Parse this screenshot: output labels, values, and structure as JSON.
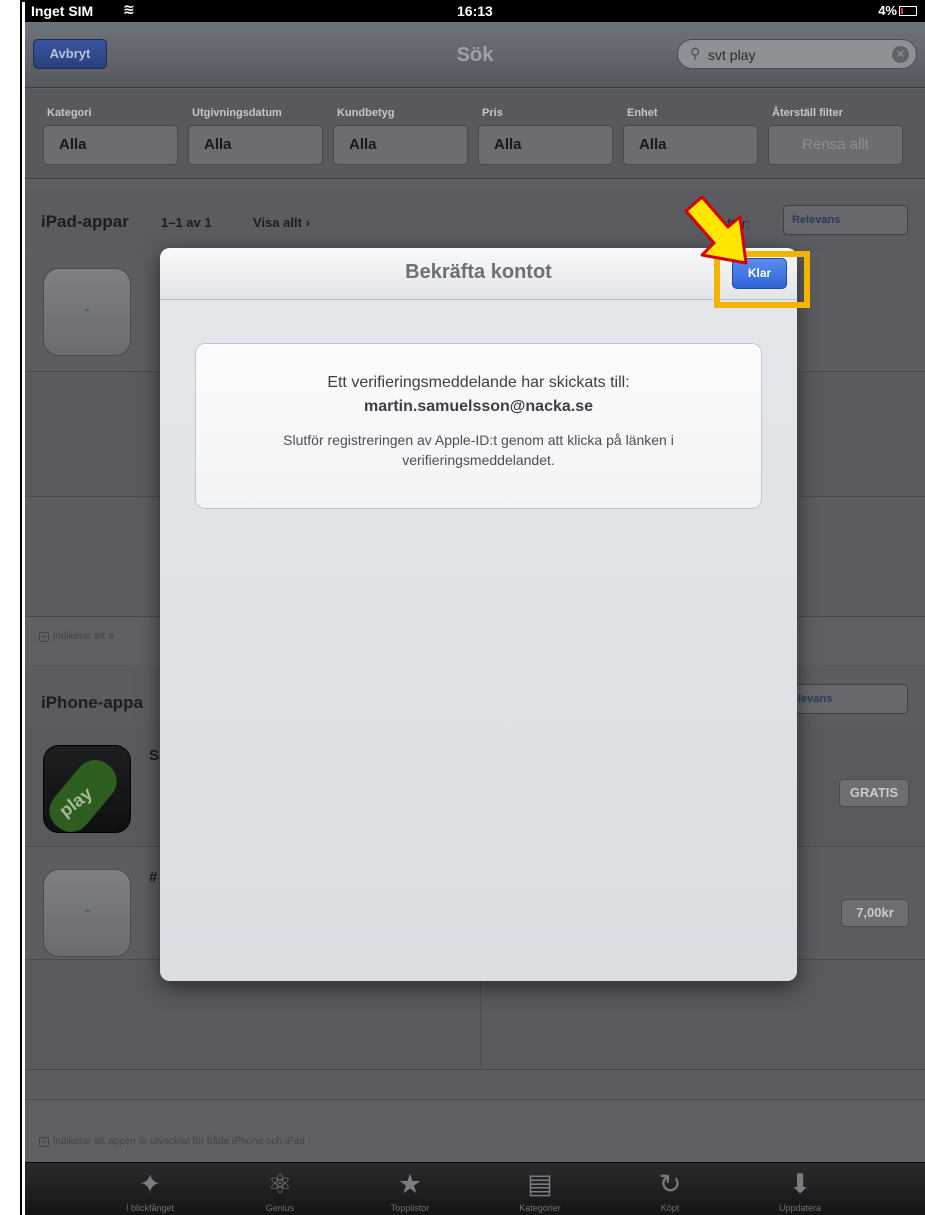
{
  "status_bar": {
    "carrier": "Inget SIM",
    "time": "16:13",
    "battery": "4%"
  },
  "nav": {
    "cancel_label": "Avbryt",
    "title": "Sök",
    "search_value": "svt play"
  },
  "filters": [
    {
      "label": "Kategori",
      "value": "Alla"
    },
    {
      "label": "Utgivningsdatum",
      "value": "Alla"
    },
    {
      "label": "Kundbetyg",
      "value": "Alla"
    },
    {
      "label": "Pris",
      "value": "Alla"
    },
    {
      "label": "Enhet",
      "value": "Alla"
    },
    {
      "label": "Återställ filter",
      "value": "Rensa allt"
    }
  ],
  "ipad_section": {
    "title": "iPad-appar",
    "count": "1–1 av 1",
    "view_all": "Visa allt ›",
    "sort_label": "ra efter:",
    "sort_value": "Relevans"
  },
  "ipad_footnote": "indikerar att a",
  "iphone_section": {
    "title": "iPhone-appa",
    "sort_value": "elevans"
  },
  "iphone_rows": [
    {
      "letter": "S",
      "price": "GRATIS"
    },
    {
      "letter": "#",
      "price": "7,00kr"
    }
  ],
  "bottom_footnote": "indikerar att appen är utvecklat för både iPhone och iPad",
  "tabs": [
    {
      "label": "I blickfånget",
      "icon": "spotlight-icon"
    },
    {
      "label": "Genius",
      "icon": "genius-icon"
    },
    {
      "label": "Topplistor",
      "icon": "star-icon"
    },
    {
      "label": "Kategorier",
      "icon": "categories-icon"
    },
    {
      "label": "Köpt",
      "icon": "purchased-icon"
    },
    {
      "label": "Uppdatera",
      "icon": "updates-icon"
    }
  ],
  "modal": {
    "title": "Bekräfta kontot",
    "done_label": "Klar",
    "line1": "Ett verifieringsmeddelande har skickats till:",
    "email": "martin.samuelsson@nacka.se",
    "line2": "Slutför registreringen av Apple-ID:t genom att klicka på länken i verifieringsmeddelandet."
  },
  "colors": {
    "accent_blue": "#2f63d6",
    "highlight_yellow": "#f3b400"
  }
}
